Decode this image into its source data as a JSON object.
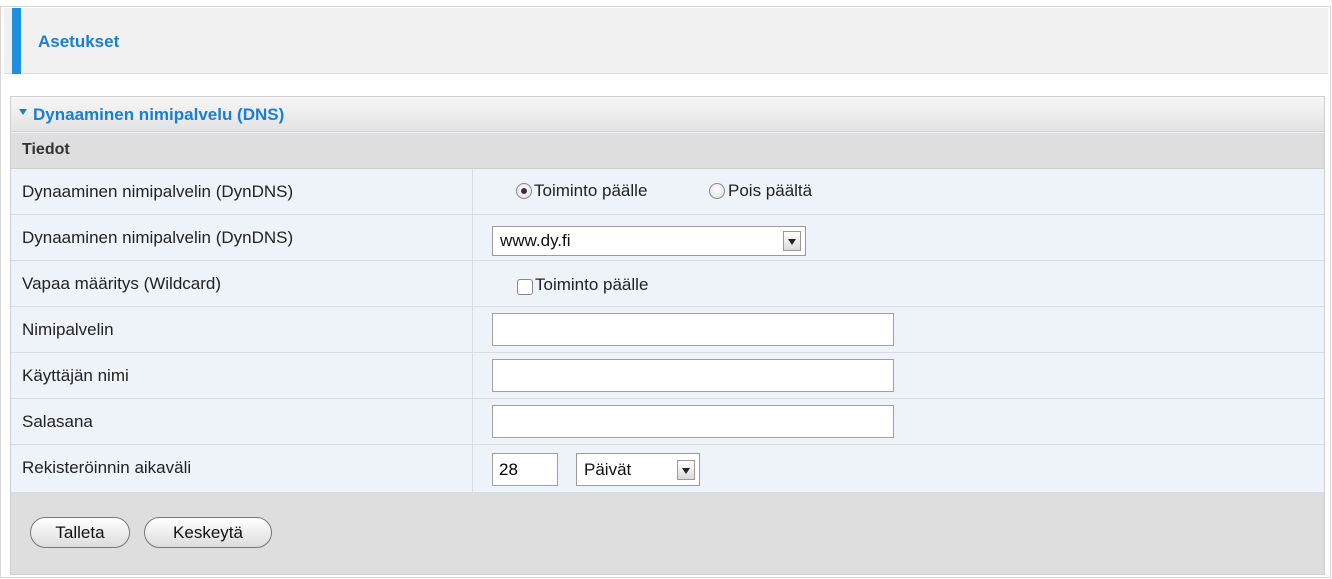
{
  "header": {
    "title": "Asetukset"
  },
  "panel": {
    "title": "Dynaaminen nimipalvelu (DNS)",
    "section_title": "Tiedot"
  },
  "rows": {
    "dyndns_enable": {
      "label": "Dynaaminen nimipalvelin (DynDNS)",
      "option_on": "Toiminto päälle",
      "option_off": "Pois päältä",
      "selected": "on"
    },
    "dyndns_provider": {
      "label": "Dynaaminen nimipalvelin (DynDNS)",
      "value": "www.dy.fi"
    },
    "wildcard": {
      "label": "Vapaa määritys (Wildcard)",
      "checkbox_label": "Toiminto päälle",
      "checked": false
    },
    "hostname": {
      "label": "Nimipalvelin",
      "value": ""
    },
    "username": {
      "label": "Käyttäjän nimi",
      "value": ""
    },
    "password": {
      "label": "Salasana",
      "value": ""
    },
    "interval": {
      "label": "Rekisteröinnin aikaväli",
      "value": "28",
      "unit": "Päivät"
    }
  },
  "buttons": {
    "save": "Talleta",
    "cancel": "Keskeytä"
  },
  "colors": {
    "accent": "#1d8fe0",
    "title_blue": "#1a7fd0",
    "row_bg": "#eef3fa"
  }
}
